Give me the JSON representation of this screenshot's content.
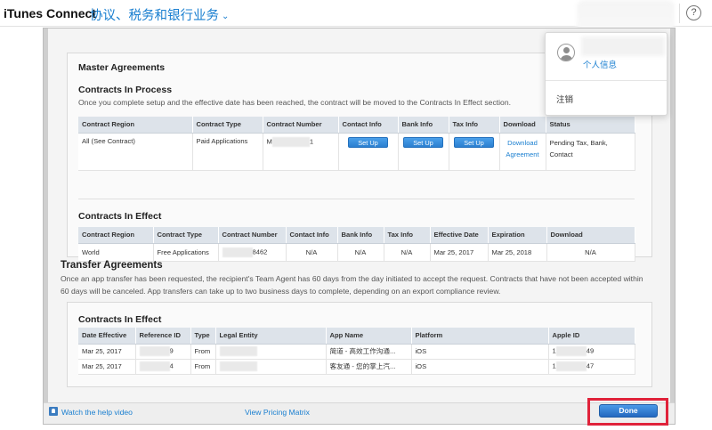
{
  "header": {
    "brand": "iTunes Connect",
    "section": "协议、税务和银行业务",
    "help_glyph": "?"
  },
  "account_menu": {
    "profile_label": "个人信息",
    "logout_label": "注销"
  },
  "master": {
    "title": "Master Agreements",
    "in_process": {
      "title": "Contracts In Process",
      "description": "Once you complete setup and the effective date has been reached, the contract will be moved to the Contracts In Effect section.",
      "columns": [
        "Contract Region",
        "Contract Type",
        "Contract Number",
        "Contact Info",
        "Bank Info",
        "Tax Info",
        "Download",
        "Status"
      ],
      "row": {
        "region": "All (See Contract)",
        "type": "Paid Applications",
        "number_prefix": "M",
        "number_suffix": "1",
        "contact_btn": "Set Up",
        "bank_btn": "Set Up",
        "tax_btn": "Set Up",
        "download_link": "Download Agreement",
        "status": "Pending Tax, Bank, Contact"
      }
    },
    "in_effect": {
      "title": "Contracts In Effect",
      "columns": [
        "Contract Region",
        "Contract Type",
        "Contract Number",
        "Contact Info",
        "Bank Info",
        "Tax Info",
        "Effective Date",
        "Expiration",
        "Download"
      ],
      "row": {
        "region": "World",
        "type": "Free Applications",
        "number_suffix": "8462",
        "contact": "N/A",
        "bank": "N/A",
        "tax": "N/A",
        "effective": "Mar 25, 2017",
        "expiration": "Mar 25, 2018",
        "download": "N/A"
      }
    }
  },
  "transfer": {
    "title": "Transfer Agreements",
    "description": "Once an app transfer has been requested, the recipient's Team Agent has 60 days from the day initiated to accept the request. Contracts that have not been accepted within 60 days will be canceled. App transfers can take up to two business days to complete, depending on an export compliance review.",
    "in_effect": {
      "title": "Contracts In Effect",
      "columns": [
        "Date Effective",
        "Reference ID",
        "Type",
        "Legal Entity",
        "App Name",
        "Platform",
        "Apple ID"
      ],
      "rows": [
        {
          "date": "Mar 25, 2017",
          "ref_suffix": "9",
          "type": "From",
          "app": "简道 - 高效工作沟通...",
          "platform": "iOS",
          "apple_prefix": "1",
          "apple_suffix": "49"
        },
        {
          "date": "Mar 25, 2017",
          "ref_suffix": "4",
          "type": "From",
          "app": "客友通 - 您的掌上汽...",
          "platform": "iOS",
          "apple_prefix": "1",
          "apple_suffix": "47"
        }
      ]
    }
  },
  "footer": {
    "help_video": "Watch the help video",
    "pricing_matrix": "View Pricing Matrix",
    "done": "Done"
  },
  "colors": {
    "accent": "#1a7fd0",
    "highlight": "#e0223a",
    "table_header": "#dde3ea"
  }
}
